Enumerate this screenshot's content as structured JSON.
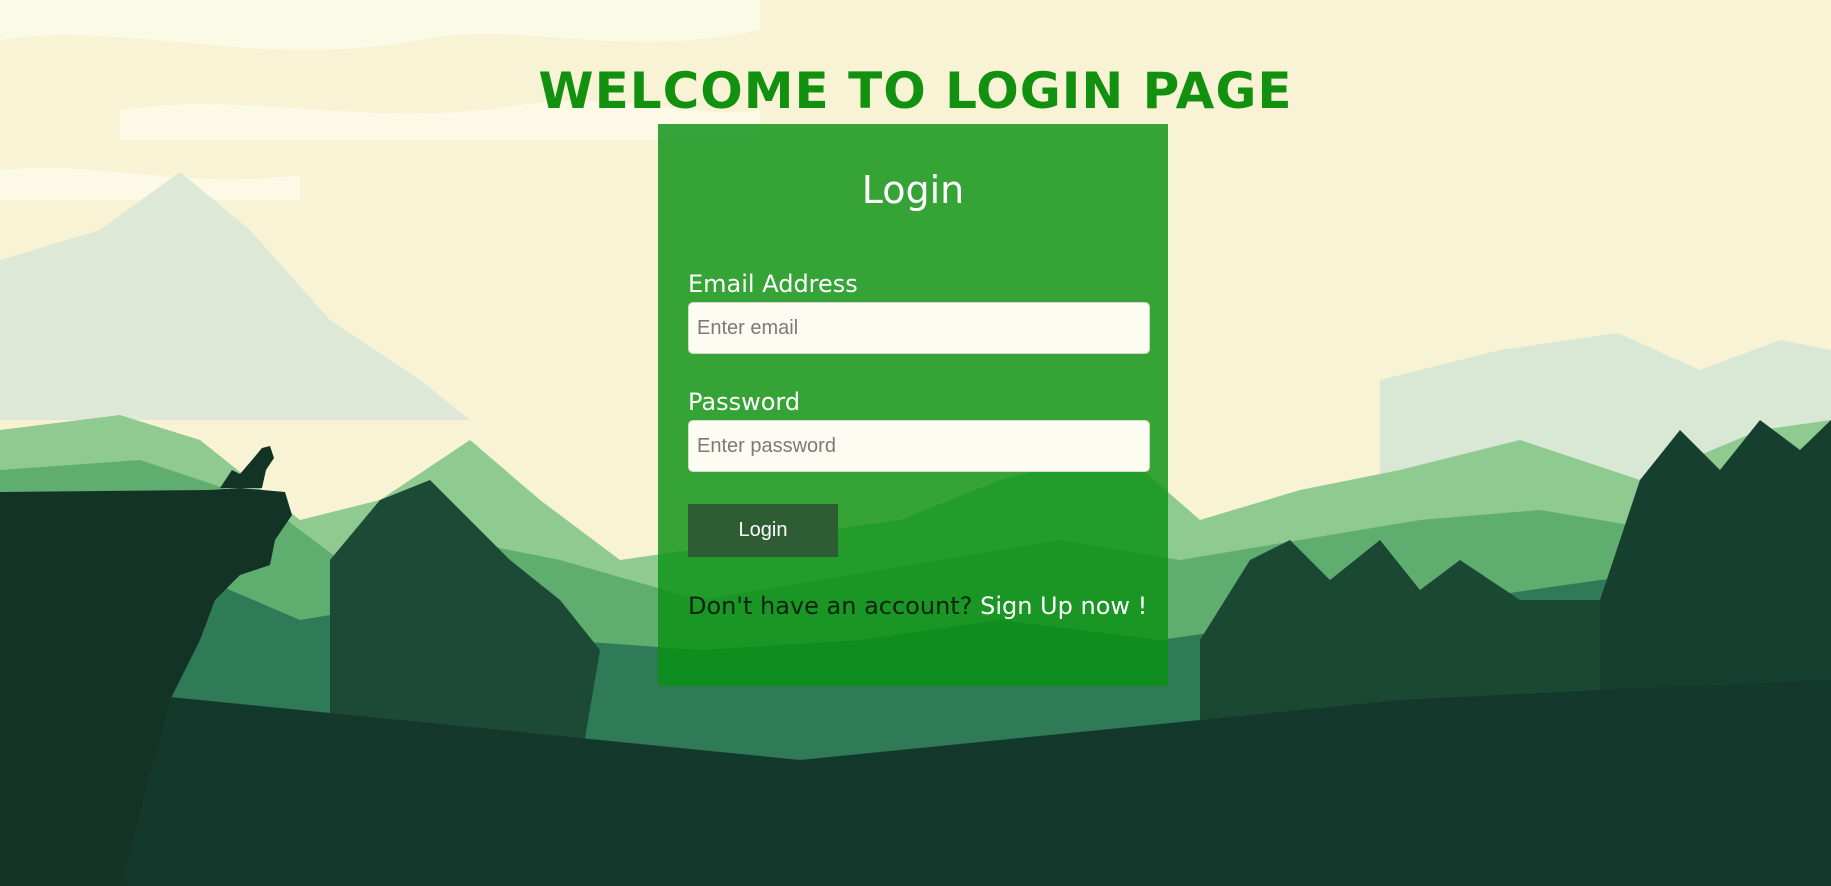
{
  "page": {
    "title": "WELCOME TO LOGIN PAGE"
  },
  "card": {
    "title": "Login",
    "email": {
      "label": "Email Address",
      "placeholder": "Enter email",
      "value": ""
    },
    "password": {
      "label": "Password",
      "placeholder": "Enter password",
      "value": ""
    },
    "submit_label": "Login",
    "signup_prompt": "Don't have an account?",
    "signup_link": "Sign Up now !"
  },
  "colors": {
    "title": "#12900f",
    "card_background": "#0a9114",
    "button": "#2e5d34",
    "sky": "#f8f3d4",
    "forest_dark": "#14382b"
  }
}
